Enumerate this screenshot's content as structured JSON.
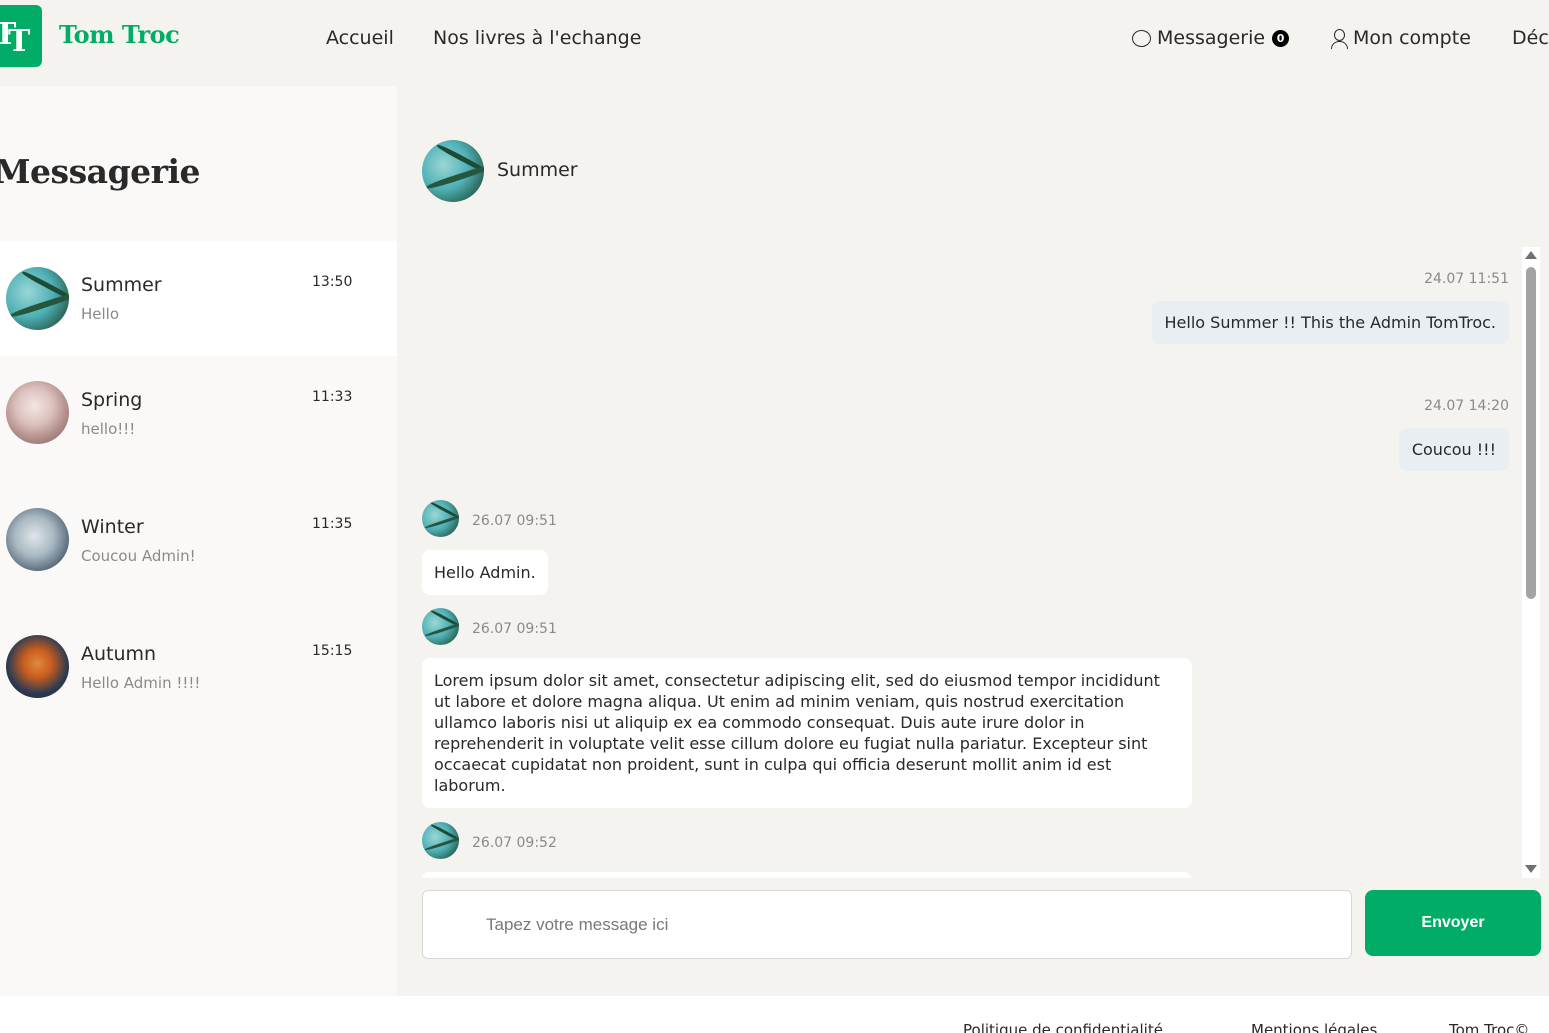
{
  "header": {
    "logo_letters_1": "T",
    "logo_letters_2": "T",
    "brand": "Tom Troc",
    "nav": {
      "home": "Accueil",
      "books": "Nos livres à l'echange",
      "messages": "Messagerie",
      "messages_count": "0",
      "account": "Mon compte",
      "logout": "Déc"
    }
  },
  "sidebar": {
    "title": "Messagerie",
    "conversations": [
      {
        "name": "Summer",
        "preview": "Hello",
        "time": "13:50",
        "active": true,
        "avatar": "summer-palm-photo"
      },
      {
        "name": "Spring",
        "preview": "hello!!!",
        "time": "11:33",
        "active": false,
        "avatar": "spring-flowers-photo"
      },
      {
        "name": "Winter",
        "preview": "Coucou Admin!",
        "time": "11:35",
        "active": false,
        "avatar": "winter-frost-photo"
      },
      {
        "name": "Autumn",
        "preview": "Hello Admin !!!!",
        "time": "15:15",
        "active": false,
        "avatar": "autumn-leaf-photo"
      }
    ]
  },
  "chat": {
    "contact_name": "Summer",
    "messages": [
      {
        "side": "right",
        "time": "24.07 11:51",
        "text": "Hello Summer !! This the Admin TomTroc."
      },
      {
        "side": "right",
        "time": "24.07 14:20",
        "text": "Coucou !!!"
      },
      {
        "side": "left",
        "time": "26.07 09:51",
        "text": "Hello Admin."
      },
      {
        "side": "left",
        "time": "26.07 09:51",
        "text": "Lorem ipsum dolor sit amet, consectetur adipiscing elit, sed do eiusmod tempor incididunt ut labore et dolore magna aliqua. Ut enim ad minim veniam, quis nostrud exercitation ullamco laboris nisi ut aliquip ex ea commodo consequat. Duis aute irure dolor in reprehenderit in voluptate velit esse cillum dolore eu fugiat nulla pariatur. Excepteur sint occaecat cupidatat non proident, sunt in culpa qui officia deserunt mollit anim id est laborum."
      },
      {
        "side": "left",
        "time": "26.07 09:52",
        "text": ""
      }
    ],
    "input_placeholder": "Tapez votre message ici",
    "send_label": "Envoyer"
  },
  "footer": {
    "privacy": "Politique de confidentialité",
    "legal": "Mentions légales",
    "copyright": "Tom Troc©"
  },
  "colors": {
    "accent": "#00ac66",
    "background": "#f5f3ef",
    "sidebar_bg": "#faf9f7",
    "own_bubble": "#e8eef2"
  }
}
